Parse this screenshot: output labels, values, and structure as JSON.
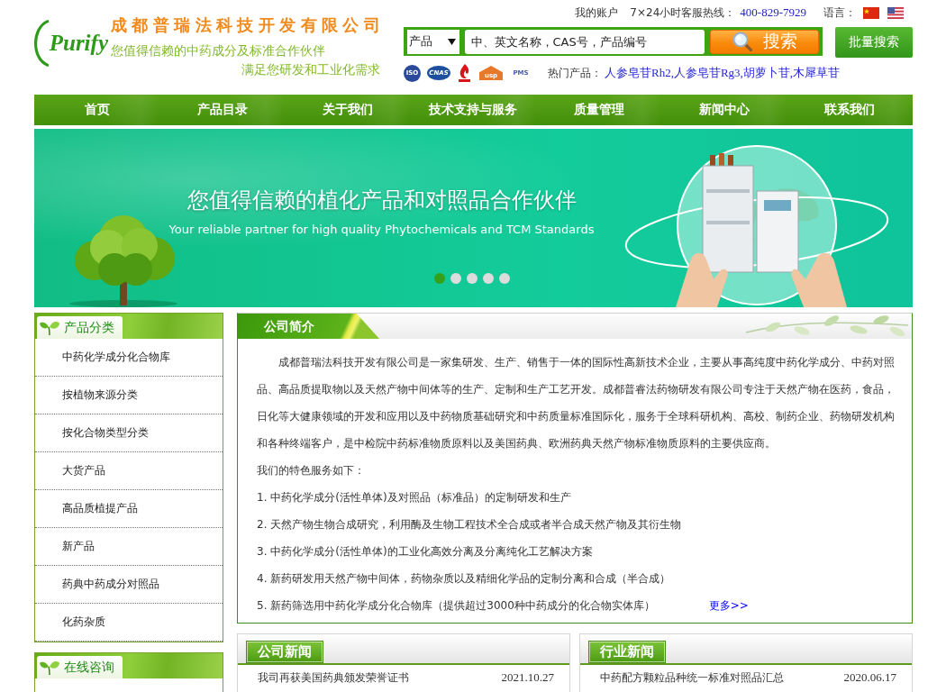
{
  "header": {
    "logo_text": "Purify",
    "company_name": "成都普瑞法科技开发有限公司",
    "tagline": "您值得信赖的中药成分及标准合作伙伴",
    "subtagline": "满足您研发和工业化需求"
  },
  "top_links": {
    "account": "我的账户",
    "hotline_label": "7×24小时客服热线：",
    "hotline": "400-829-7929",
    "language_label": "语言："
  },
  "languages": [
    {
      "kind": "cn"
    },
    {
      "kind": "us"
    }
  ],
  "search": {
    "category": "产品",
    "placeholder": "中、英文名称，CAS号，产品编号",
    "button": "搜索",
    "bulk_button": "批量搜索"
  },
  "certifications": [
    {
      "kind": "iso",
      "label": "ISO"
    },
    {
      "kind": "cnas",
      "label": "CNAS"
    },
    {
      "kind": "emblem"
    },
    {
      "kind": "usp",
      "label": "usp"
    },
    {
      "kind": "pms",
      "label": "PMS"
    }
  ],
  "hot_products": {
    "label": "热门产品：",
    "items": [
      "人参皂苷Rh2,",
      "人参皂苷Rg3,",
      "胡萝卜苷,",
      "木犀草苷"
    ]
  },
  "nav": [
    "首页",
    "产品目录",
    "关于我们",
    "技术支持与服务",
    "质量管理",
    "新闻中心",
    "联系我们"
  ],
  "banner": {
    "title": "您值得信赖的植化产品和对照品合作伙伴",
    "subtitle": "Your reliable partner for high quality Phytochemicals and TCM Standards",
    "slides": [
      {
        "selected": true
      },
      {
        "selected": false
      },
      {
        "selected": false
      },
      {
        "selected": false
      },
      {
        "selected": false
      }
    ]
  },
  "sidebar": [
    {
      "title": "产品分类",
      "items": [
        "中药化学成分化合物库",
        "按植物来源分类",
        "按化合物类型分类",
        "大货产品",
        "高品质植提产品",
        "新产品",
        "药典中药成分对照品",
        "化药杂质"
      ]
    },
    {
      "title": "在线咨询"
    }
  ],
  "intro": {
    "title": "公司简介",
    "paragraph": "成都普瑞法科技开发有限公司是一家集研发、生产、销售于一体的国际性高新技术企业，主要从事高纯度中药化学成分、中药对照品、高品质提取物以及天然产物中间体等的生产、定制和生产工艺开发。成都普睿法药物研发有限公司专注于天然产物在医药，食品，日化等大健康领域的开发和应用以及中药物质基础研究和中药质量标准国际化，服务于全球科研机构、高校、制药企业、药物研发机构和各种终端客户，是中检院中药标准物质原料以及美国药典、欧洲药典天然产物标准物质原料的主要供应商。",
    "services_heading": "我们的特色服务如下：",
    "services": [
      "1. 中药化学成分(活性单体)及对照品（标准品）的定制研发和生产",
      "2. 天然产物生物合成研究，利用酶及生物工程技术全合成或者半合成天然产物及其衍生物",
      "3. 中药化学成分(活性单体)的工业化高效分离及分离纯化工艺解决方案",
      "4. 新药研发用天然产物中间体，药物杂质以及精细化学品的定制分离和合成（半合成）",
      "5. 新药筛选用中药化学成分化合物库（提供超过3000种中药成分的化合物实体库）"
    ],
    "more_link": "更多>>"
  },
  "news": [
    {
      "title": "公司新闻",
      "items": [
        {
          "title": "我司再获美国药典颁发荣誉证书",
          "date": "2021.10.27"
        }
      ]
    },
    {
      "title": "行业新闻",
      "items": [
        {
          "title": "中药配方颗粒品种统一标准对照品汇总",
          "date": "2020.06.17"
        }
      ]
    }
  ]
}
